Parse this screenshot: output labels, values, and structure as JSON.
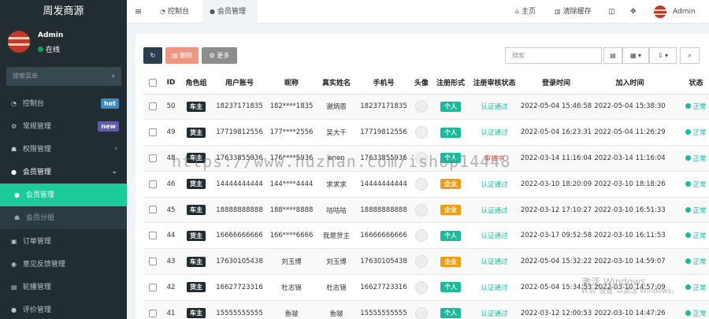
{
  "app": {
    "brand": "周发商源"
  },
  "user": {
    "name": "Admin",
    "status": "在线"
  },
  "sidebar": {
    "search_placeholder": "搜索菜单",
    "items": [
      {
        "label": "控制台",
        "badge": "hot",
        "badge_color": "#3c8dbc",
        "icon": "dashboard-icon"
      },
      {
        "label": "常规管理",
        "badge": "new",
        "badge_color": "#605ca8",
        "icon": "cogs-icon"
      },
      {
        "label": "权限管理",
        "chevron": "‹",
        "icon": "group-icon"
      },
      {
        "label": "会员管理",
        "chevron": "⌄",
        "icon": "user-icon"
      },
      {
        "label": "会员管理",
        "active": true,
        "icon": "user-icon"
      },
      {
        "label": "会员分组",
        "icon": "users-icon"
      },
      {
        "label": "订单管理",
        "icon": "order-icon"
      },
      {
        "label": "意见反馈管理",
        "icon": "feedback-icon"
      },
      {
        "label": "轮播管理",
        "icon": "image-icon"
      },
      {
        "label": "评价管理",
        "icon": "comment-icon"
      }
    ]
  },
  "topbar": {
    "tabs": [
      {
        "label": "控制台",
        "icon": "dashboard-icon"
      },
      {
        "label": "会员管理",
        "icon": "user-icon"
      }
    ],
    "home": "主页",
    "clear_cache": "清除缓存",
    "admin": "Admin"
  },
  "toolbar": {
    "delete_label": "删除",
    "more_label": "更多",
    "search_placeholder": "搜索"
  },
  "table": {
    "headers": [
      "ID",
      "角色组",
      "用户账号",
      "昵称",
      "真实姓名",
      "手机号",
      "头像",
      "注册形式",
      "注册审核状态",
      "登录时间",
      "加入时间",
      "状态"
    ],
    "rows": [
      {
        "id": "50",
        "role": "车主",
        "account": "18237171835",
        "nickname": "182****1835",
        "real_name": "谢炳恩",
        "phone": "18237171835",
        "type": "个人",
        "type_color": "#18bc9c",
        "audit": "认证通过",
        "audit_color": "#18bc9c",
        "login": "2022-05-04 15:46:58",
        "joined": "2022-05-04 15:38:30",
        "status": "正常"
      },
      {
        "id": "49",
        "role": "货主",
        "account": "17719812556",
        "nickname": "177****2556",
        "real_name": "吴大千",
        "phone": "17719812556",
        "type": "个人",
        "type_color": "#18bc9c",
        "audit": "认证通过",
        "audit_color": "#18bc9c",
        "login": "2022-05-04 16:23:31",
        "joined": "2022-05-04 11:26:29",
        "status": "正常"
      },
      {
        "id": "48",
        "role": "车主",
        "account": "17633855936",
        "nickname": "176****5936",
        "real_name": "enen",
        "phone": "17633855936",
        "type": "个人",
        "type_color": "#18bc9c",
        "audit": "审核中",
        "audit_color": "#e74c3c",
        "login": "2022-03-14 11:16:04",
        "joined": "2022-03-14 11:16:04",
        "status": "正常"
      },
      {
        "id": "46",
        "role": "货主",
        "account": "14444444444",
        "nickname": "144****4444",
        "real_name": "求求求",
        "phone": "14444444444",
        "type": "企业",
        "type_color": "#f39c12",
        "audit": "认证通过",
        "audit_color": "#18bc9c",
        "login": "2022-03-10 18:20:09",
        "joined": "2022-03-10 18:18:26",
        "status": "正常"
      },
      {
        "id": "45",
        "role": "车主",
        "account": "18888888888",
        "nickname": "188****8888",
        "real_name": "咕咕咕",
        "phone": "18888888888",
        "type": "企业",
        "type_color": "#f39c12",
        "audit": "认证通过",
        "audit_color": "#18bc9c",
        "login": "2022-03-12 17:10:27",
        "joined": "2022-03-10 16:51:33",
        "status": "正常"
      },
      {
        "id": "44",
        "role": "货主",
        "account": "16666666666",
        "nickname": "166****6666",
        "real_name": "我是货主",
        "phone": "16666666666",
        "type": "个人",
        "type_color": "#18bc9c",
        "audit": "认证通过",
        "audit_color": "#18bc9c",
        "login": "2022-03-17 09:52:58",
        "joined": "2022-03-10 16:11:53",
        "status": "正常"
      },
      {
        "id": "43",
        "role": "车主",
        "account": "17630105438",
        "nickname": "刘玉博",
        "real_name": "刘玉博",
        "phone": "17630105438",
        "type": "企业",
        "type_color": "#f39c12",
        "audit": "认证通过",
        "audit_color": "#18bc9c",
        "login": "2022-05-04 15:32:22",
        "joined": "2022-03-10 14:59:07",
        "status": "正常"
      },
      {
        "id": "42",
        "role": "货主",
        "account": "16627723316",
        "nickname": "杜志锦",
        "real_name": "杜志锦",
        "phone": "16627723316",
        "type": "个人",
        "type_color": "#18bc9c",
        "audit": "认证通过",
        "audit_color": "#18bc9c",
        "login": "2022-05-04 15:34:53",
        "joined": "2022-03-10 14:57:09",
        "status": "正常"
      },
      {
        "id": "41",
        "role": "车主",
        "account": "15555555555",
        "nickname": "鱼啵",
        "real_name": "鱼啵",
        "phone": "15555555555",
        "type": "个人",
        "type_color": "#18bc9c",
        "audit": "认证通过",
        "audit_color": "#18bc9c",
        "login": "2022-03-12 12:00:53",
        "joined": "2022-03-10 14:47:26",
        "status": "正常"
      }
    ]
  },
  "overlay": {
    "watermark": "https://www.huzhan.com/ishop14448",
    "windows_activate_line1": "激活 Windows",
    "windows_activate_line2": "转到\"设置\"以激活 Windows。"
  }
}
